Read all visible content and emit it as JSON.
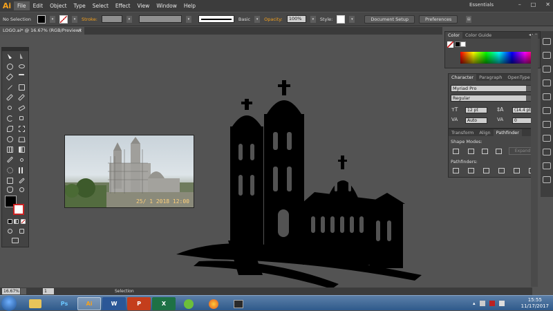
{
  "app": {
    "logo": "Ai"
  },
  "menu": [
    "File",
    "Edit",
    "Object",
    "Type",
    "Select",
    "Effect",
    "View",
    "Window",
    "Help"
  ],
  "workspace": "Essentials",
  "window_controls": [
    "–",
    "□",
    "✕"
  ],
  "control_bar": {
    "selection": "No Selection",
    "stroke_label": "Stroke:",
    "brush": "Basic",
    "opacity_label": "Opacity:",
    "opacity": "100%",
    "style_label": "Style:",
    "document_setup": "Document Setup",
    "preferences": "Preferences"
  },
  "doc_tab": {
    "title": "LOGO.ai* @ 16.67% (RGB/Preview)",
    "close": "×"
  },
  "photo": {
    "date_stamp": "25/ 1 2018  12:00"
  },
  "color_panel": {
    "tabs": [
      "Color",
      "Color Guide"
    ]
  },
  "character_panel": {
    "tabs": [
      "Character",
      "Paragraph",
      "OpenType"
    ],
    "font_family": "Myriad Pro",
    "font_style": "Regular",
    "font_size": "12 pt",
    "leading": "(14.4 pt)",
    "kerning": "Auto",
    "tracking": "0"
  },
  "pathfinder_panel": {
    "tabs": [
      "Transform",
      "Align",
      "Pathfinder"
    ],
    "shape_modes_label": "Shape Modes:",
    "expand_label": "Expand",
    "pathfinders_label": "Pathfinders:"
  },
  "status": {
    "zoom": "16.67%",
    "page": "1",
    "tool": "Selection"
  },
  "taskbar": {
    "apps": [
      "Ps",
      "Ai",
      "W",
      "P",
      "X"
    ],
    "time": "15:55",
    "date": "11/17/2017"
  },
  "colors": {
    "accent": "#f7a21c",
    "ui_bg": "#535353",
    "panel": "#474747"
  }
}
